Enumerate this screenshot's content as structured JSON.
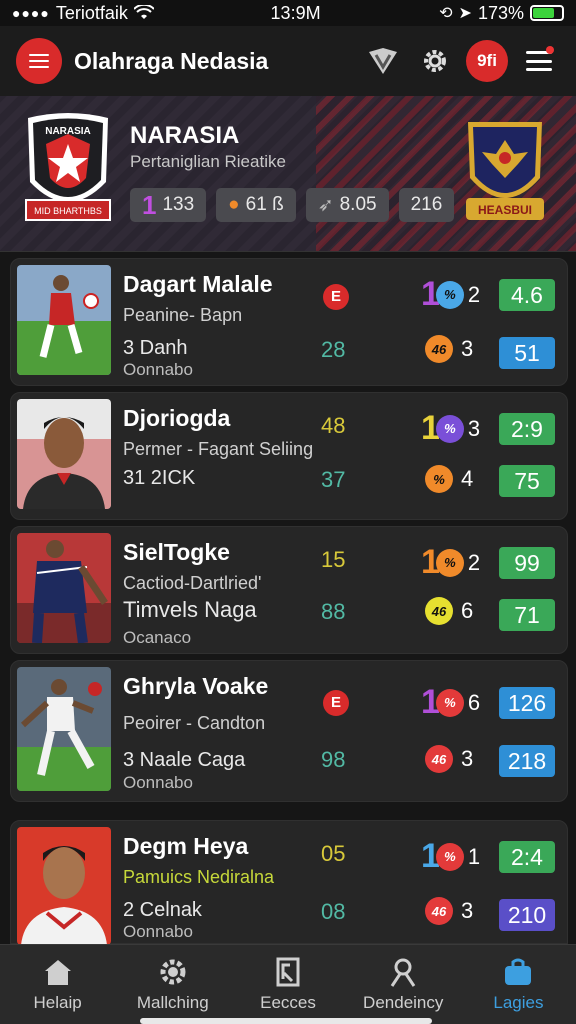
{
  "status_bar": {
    "carrier": "Teriotfaik",
    "time": "13:9M",
    "battery": "173%",
    "battery_level": 0.75
  },
  "header": {
    "title": "Olahraga Nedasia",
    "badge_text": "9fi"
  },
  "team": {
    "name": "NARASIA",
    "subtitle": "Pertaniglian Rieatike",
    "crest_text": "NARASIA",
    "crest_banner": "MID BHARTHBS",
    "right_crest_banner": "HEASBUI",
    "stats": [
      {
        "icon": "1",
        "value": "133"
      },
      {
        "icon": "person-icon",
        "value": "61 ß"
      },
      {
        "icon": "bird-icon",
        "value": "8.05"
      },
      {
        "icon": "",
        "value": "216"
      }
    ]
  },
  "players": [
    {
      "name": "Dagart Malale",
      "role": "Peanine- Bapn",
      "line3": "3 Danh",
      "line4": "Oonnabo",
      "stat1": "E",
      "stat1_is_badge": true,
      "stat2": "28",
      "rank_big": "1",
      "rank_big_color": "#b04fd8",
      "badge1_color": "#4aa8e8",
      "badge1_text": "%",
      "rank_num": "2",
      "badge2_color": "#f08a2a",
      "badge2_text": "46",
      "num2": "3",
      "score1": "4.6",
      "score1_color": "#3aa858",
      "score2": "51",
      "score2_color": "#2e8fd6"
    },
    {
      "name": "Djoriogda",
      "role": "Permer - Fagant Seliing",
      "line3": "31 2ICK",
      "line4": "",
      "stat1": "48",
      "stat1_is_badge": false,
      "stat1_color": "#d8c93a",
      "stat2": "37",
      "rank_big": "1",
      "rank_big_color": "#e8d23a",
      "badge1_color": "#7a4fd8",
      "badge1_text": "%",
      "rank_num": "3",
      "badge2_color": "#f08a2a",
      "badge2_text": "%",
      "num2": "4",
      "score1": "2:9",
      "score1_color": "#3aa858",
      "score2": "75",
      "score2_color": "#3aa858"
    },
    {
      "name": "SielTogke",
      "role": "Cactiod-Dartlried'",
      "line3": "Timvels Naga",
      "line4": "Ocanaco",
      "stat1": "15",
      "stat1_is_badge": false,
      "stat1_color": "#d8c93a",
      "stat2": "88",
      "rank_big": "1",
      "rank_big_color": "#f08a2a",
      "badge1_color": "#f08a2a",
      "badge1_text": "%",
      "rank_num": "2",
      "badge2_color": "#e6e030",
      "badge2_text": "46",
      "num2": "6",
      "score1": "99",
      "score1_color": "#3aa858",
      "score2": "71",
      "score2_color": "#3aa858"
    },
    {
      "name": "Ghryla Voake",
      "role": "Peoirer - Candton",
      "line3": "3 Naale Caga",
      "line4": "Oonnabo",
      "stat1": "E",
      "stat1_is_badge": true,
      "stat2": "98",
      "rank_big": "1",
      "rank_big_color": "#b04fd8",
      "badge1_color": "#e33a3a",
      "badge1_text": "%",
      "rank_num": "6",
      "badge2_color": "#e33a3a",
      "badge2_text": "46",
      "num2": "3",
      "score1": "126",
      "score1_color": "#2e8fd6",
      "score2": "218",
      "score2_color": "#2e8fd6"
    },
    {
      "name": "Degm Heya",
      "role": "Pamuics Nediralna",
      "role_color": "#c6d83a",
      "line3": "2 Celnak",
      "line4": "Oonnabo",
      "stat1": "05",
      "stat1_is_badge": false,
      "stat1_color": "#d8c93a",
      "stat2": "08",
      "rank_big": "1",
      "rank_big_color": "#4aa8e8",
      "badge1_color": "#e33a3a",
      "badge1_text": "%",
      "rank_num": "1",
      "badge2_color": "#e33a3a",
      "badge2_text": "46",
      "num2": "3",
      "score1": "2:4",
      "score1_color": "#3aa858",
      "score2": "210",
      "score2_color": "#5a4fc8"
    }
  ],
  "nav": [
    {
      "label": "Helaip",
      "icon": "home-icon",
      "active": false
    },
    {
      "label": "Mallching",
      "icon": "gear-icon",
      "active": false
    },
    {
      "label": "Eecces",
      "icon": "chart-icon",
      "active": false
    },
    {
      "label": "Dendeincy",
      "icon": "person-icon",
      "active": false
    },
    {
      "label": "Lagies",
      "icon": "bag-icon",
      "active": true
    }
  ]
}
